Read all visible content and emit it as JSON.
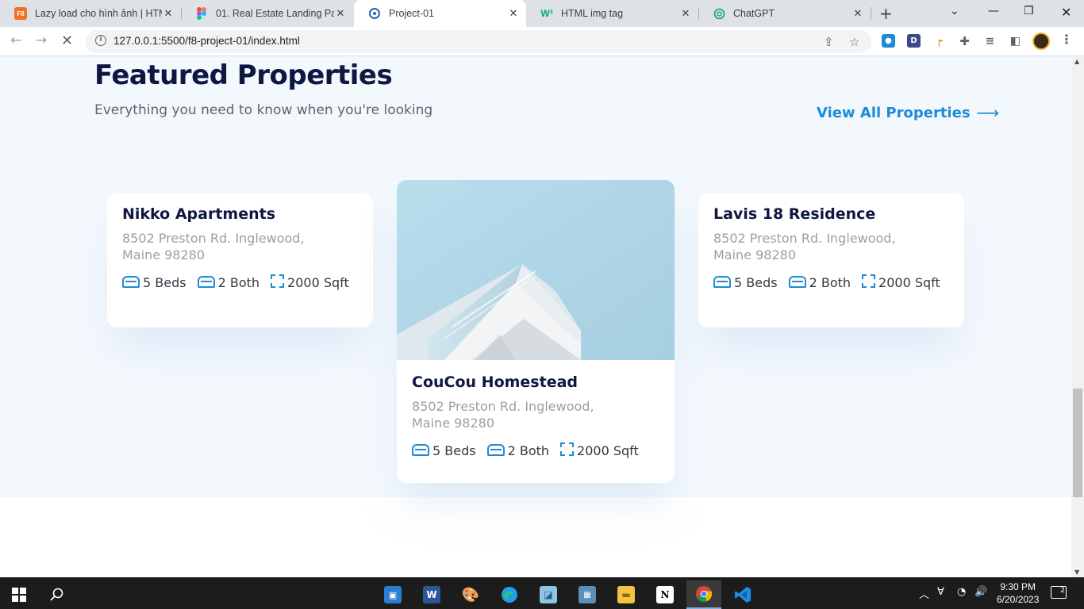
{
  "browser": {
    "tabs": [
      {
        "title": "Lazy load cho hình ảnh | HTM",
        "favicon": "F8"
      },
      {
        "title": "01. Real Estate Landing Page",
        "favicon": ""
      },
      {
        "title": "Project-01",
        "favicon": ""
      },
      {
        "title": "HTML img tag",
        "favicon": "W³"
      },
      {
        "title": "ChatGPT",
        "favicon": ""
      }
    ],
    "active_tab": 2,
    "url": "127.0.0.1:5500/f8-project-01/index.html",
    "extensions": [
      "D"
    ]
  },
  "page": {
    "heading": "Featured Properties",
    "subheading": "Everything you need to know when you're looking",
    "view_all": "View All Properties",
    "cards": [
      {
        "name": "Nikko Apartments",
        "address": "8502 Preston Rd. Inglewood, Maine 98280",
        "beds": "5 Beds",
        "baths": "2 Both",
        "area": "2000 Sqft"
      },
      {
        "name": "CouCou Homestead",
        "address": "8502 Preston Rd. Inglewood, Maine 98280",
        "beds": "5 Beds",
        "baths": "2 Both",
        "area": "2000 Sqft"
      },
      {
        "name": "Lavis 18 Residence",
        "address": "8502 Preston Rd. Inglewood, Maine 98280",
        "beds": "5 Beds",
        "baths": "2 Both",
        "area": "2000 Sqft"
      }
    ]
  },
  "taskbar": {
    "time": "9:30 PM",
    "date": "6/20/2023",
    "notifications": "2",
    "apps": [
      "Word",
      "Notion"
    ]
  },
  "colors": {
    "accent": "#1c8bd8",
    "heading": "#0d1742",
    "section_bg": "#f3f8fd"
  }
}
